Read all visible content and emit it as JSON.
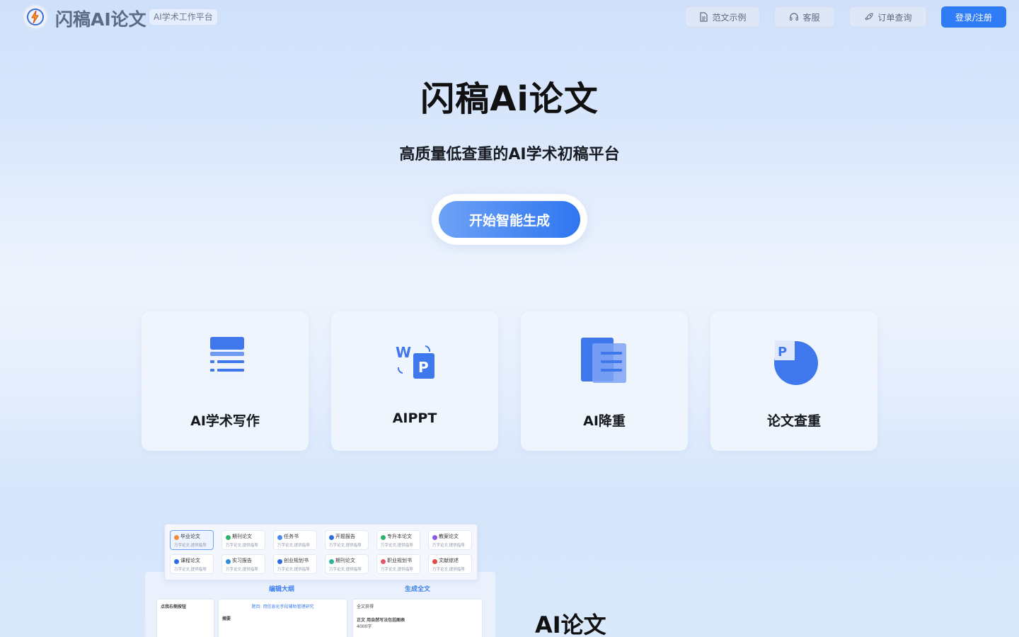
{
  "header": {
    "brand": "闪稿AI论文",
    "tag": "AI学术工作平台",
    "nav": [
      {
        "label": "范文示例",
        "icon": "document-icon"
      },
      {
        "label": "客服",
        "icon": "headset-icon"
      },
      {
        "label": "订单查询",
        "icon": "rocket-icon"
      }
    ],
    "login": "登录/注册"
  },
  "hero": {
    "title": "闪稿Ai论文",
    "subtitle": "高质量低查重的AI学术初稿平台",
    "cta": "开始智能生成"
  },
  "cards": [
    {
      "label": "AI学术写作",
      "icon": "writing-icon"
    },
    {
      "label": "AIPPT",
      "icon": "word-to-ppt-icon"
    },
    {
      "label": "AI降重",
      "icon": "stacked-docs-icon"
    },
    {
      "label": "论文查重",
      "icon": "pie-p-icon"
    }
  ],
  "preview": {
    "chips_row1": [
      {
        "name": "毕业论文",
        "sub": "万字论文,提供指导",
        "color": "#f08c3a"
      },
      {
        "name": "期刊论文",
        "sub": "万字论文,提供指导",
        "color": "#2fb36b"
      },
      {
        "name": "任务书",
        "sub": "万字论文,提供指导",
        "color": "#4a8af0"
      },
      {
        "name": "开题报告",
        "sub": "万字论文,提供指导",
        "color": "#2f6de0"
      },
      {
        "name": "专升本论文",
        "sub": "万字论文,提供指导",
        "color": "#2fb36b"
      },
      {
        "name": "教案论文",
        "sub": "万字论文,提供指导",
        "color": "#8a5ae0"
      }
    ],
    "chips_row2": [
      {
        "name": "课程论文",
        "sub": "万字论文,提供指导",
        "color": "#2f6de0"
      },
      {
        "name": "实习报告",
        "sub": "万字论文,提供指导",
        "color": "#2f8de0"
      },
      {
        "name": "创业规划书",
        "sub": "万字论文,提供指导",
        "color": "#2f6de0"
      },
      {
        "name": "期刊论文",
        "sub": "万字论文,提供指导",
        "color": "#2fb3a0"
      },
      {
        "name": "职业规划书",
        "sub": "万字论文,提供指导",
        "color": "#e05a6a"
      },
      {
        "name": "文献综述",
        "sub": "万字论文,提供指导",
        "color": "#e04a4a"
      }
    ],
    "tab_outline": "编辑大纲",
    "tab_full": "生成全文",
    "panel1_title": "点我右侧按钮",
    "panel2_title": "题目: 用信息化手段辅助管理研究",
    "panel2_sub": "摘要",
    "panel3_title": "全文获得",
    "panel3_line": "正文 用自然写法包括图表",
    "panel3_count": "4000字"
  },
  "section_title": "AI论文"
}
